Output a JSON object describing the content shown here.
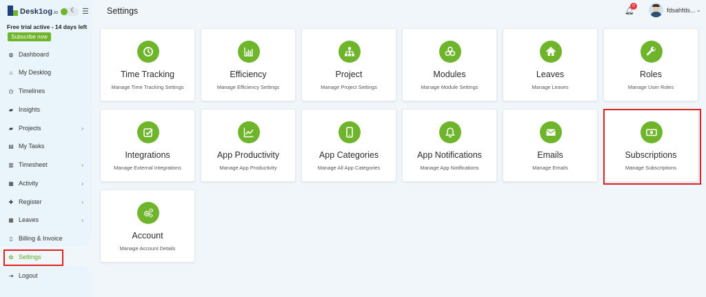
{
  "app": {
    "logo_text": "Desk1og",
    "logo_suffix": ".io",
    "trial_text": "Free trial active - 14 days left",
    "subscribe_label": "Subscribe now"
  },
  "sidebar": {
    "items": [
      {
        "label": "Dashboard",
        "icon": "dashboard-icon"
      },
      {
        "label": "My Desklog",
        "icon": "home-icon"
      },
      {
        "label": "Timelines",
        "icon": "clock-icon"
      },
      {
        "label": "Insights",
        "icon": "book-icon"
      },
      {
        "label": "Projects",
        "icon": "folder-icon",
        "has_submenu": true
      },
      {
        "label": "My Tasks",
        "icon": "tasks-icon"
      },
      {
        "label": "Timesheet",
        "icon": "timesheet-icon",
        "has_submenu": true
      },
      {
        "label": "Activity",
        "icon": "grid-icon",
        "has_submenu": true
      },
      {
        "label": "Register",
        "icon": "plus-icon",
        "has_submenu": true
      },
      {
        "label": "Leaves",
        "icon": "calendar-icon",
        "has_submenu": true
      },
      {
        "label": "Billing & Invoice",
        "icon": "invoice-icon"
      },
      {
        "label": "Settings",
        "icon": "gear-icon",
        "active": true
      },
      {
        "label": "Logout",
        "icon": "logout-icon"
      }
    ]
  },
  "header": {
    "title": "Settings",
    "notification_count": "0",
    "username": "fdsahfds..."
  },
  "cards": [
    {
      "title": "Time Tracking",
      "subtitle": "Manage Time Tracking Settings",
      "icon": "clock-icon"
    },
    {
      "title": "Efficiency",
      "subtitle": "Manage Efficiency Settings",
      "icon": "bar-chart-icon"
    },
    {
      "title": "Project",
      "subtitle": "Manage Project Settings",
      "icon": "sitemap-icon"
    },
    {
      "title": "Modules",
      "subtitle": "Manage Module Settings",
      "icon": "cubes-icon"
    },
    {
      "title": "Leaves",
      "subtitle": "Manage Leaves",
      "icon": "home-icon"
    },
    {
      "title": "Roles",
      "subtitle": "Manage User Roles",
      "icon": "wrench-icon"
    },
    {
      "title": "Integrations",
      "subtitle": "Manage External Integrations",
      "icon": "check-square-icon"
    },
    {
      "title": "App Productivity",
      "subtitle": "Manage App Productivity",
      "icon": "line-chart-icon"
    },
    {
      "title": "App Categories",
      "subtitle": "Manage All App Categories",
      "icon": "mobile-icon"
    },
    {
      "title": "App Notifications",
      "subtitle": "Manage App Notifications",
      "icon": "bell-icon"
    },
    {
      "title": "Emails",
      "subtitle": "Manage Emails",
      "icon": "envelope-icon"
    },
    {
      "title": "Subscriptions",
      "subtitle": "Manage Subscriptions",
      "icon": "money-icon",
      "highlighted": true
    },
    {
      "title": "Account",
      "subtitle": "Manage Account Details",
      "icon": "gears-icon"
    }
  ],
  "colors": {
    "accent": "#6fb52c",
    "highlight": "#e02020",
    "background": "#f1f6fb"
  }
}
